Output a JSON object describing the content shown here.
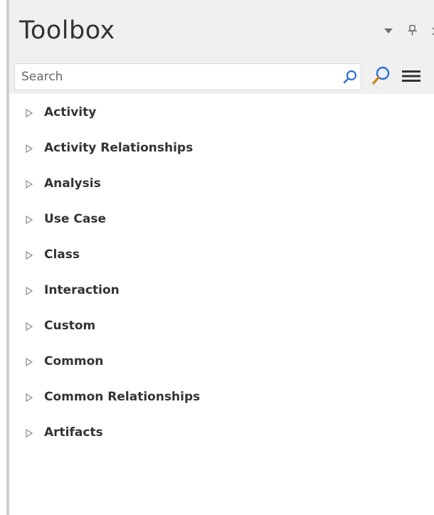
{
  "panel": {
    "title": "Toolbox",
    "buttons": {
      "dropdown_icon": "triangle-down",
      "pin_icon": "pin",
      "close_icon": "close"
    }
  },
  "search": {
    "placeholder": "Search",
    "value": ""
  },
  "colors": {
    "accent": "#2f6fd6",
    "text": "#333333",
    "header_bg": "#f0f0f0"
  },
  "toolbox": {
    "items": [
      {
        "label": "Activity"
      },
      {
        "label": "Activity Relationships"
      },
      {
        "label": "Analysis"
      },
      {
        "label": "Use Case"
      },
      {
        "label": "Class"
      },
      {
        "label": "Interaction"
      },
      {
        "label": "Custom"
      },
      {
        "label": "Common"
      },
      {
        "label": "Common Relationships"
      },
      {
        "label": "Artifacts"
      }
    ]
  }
}
